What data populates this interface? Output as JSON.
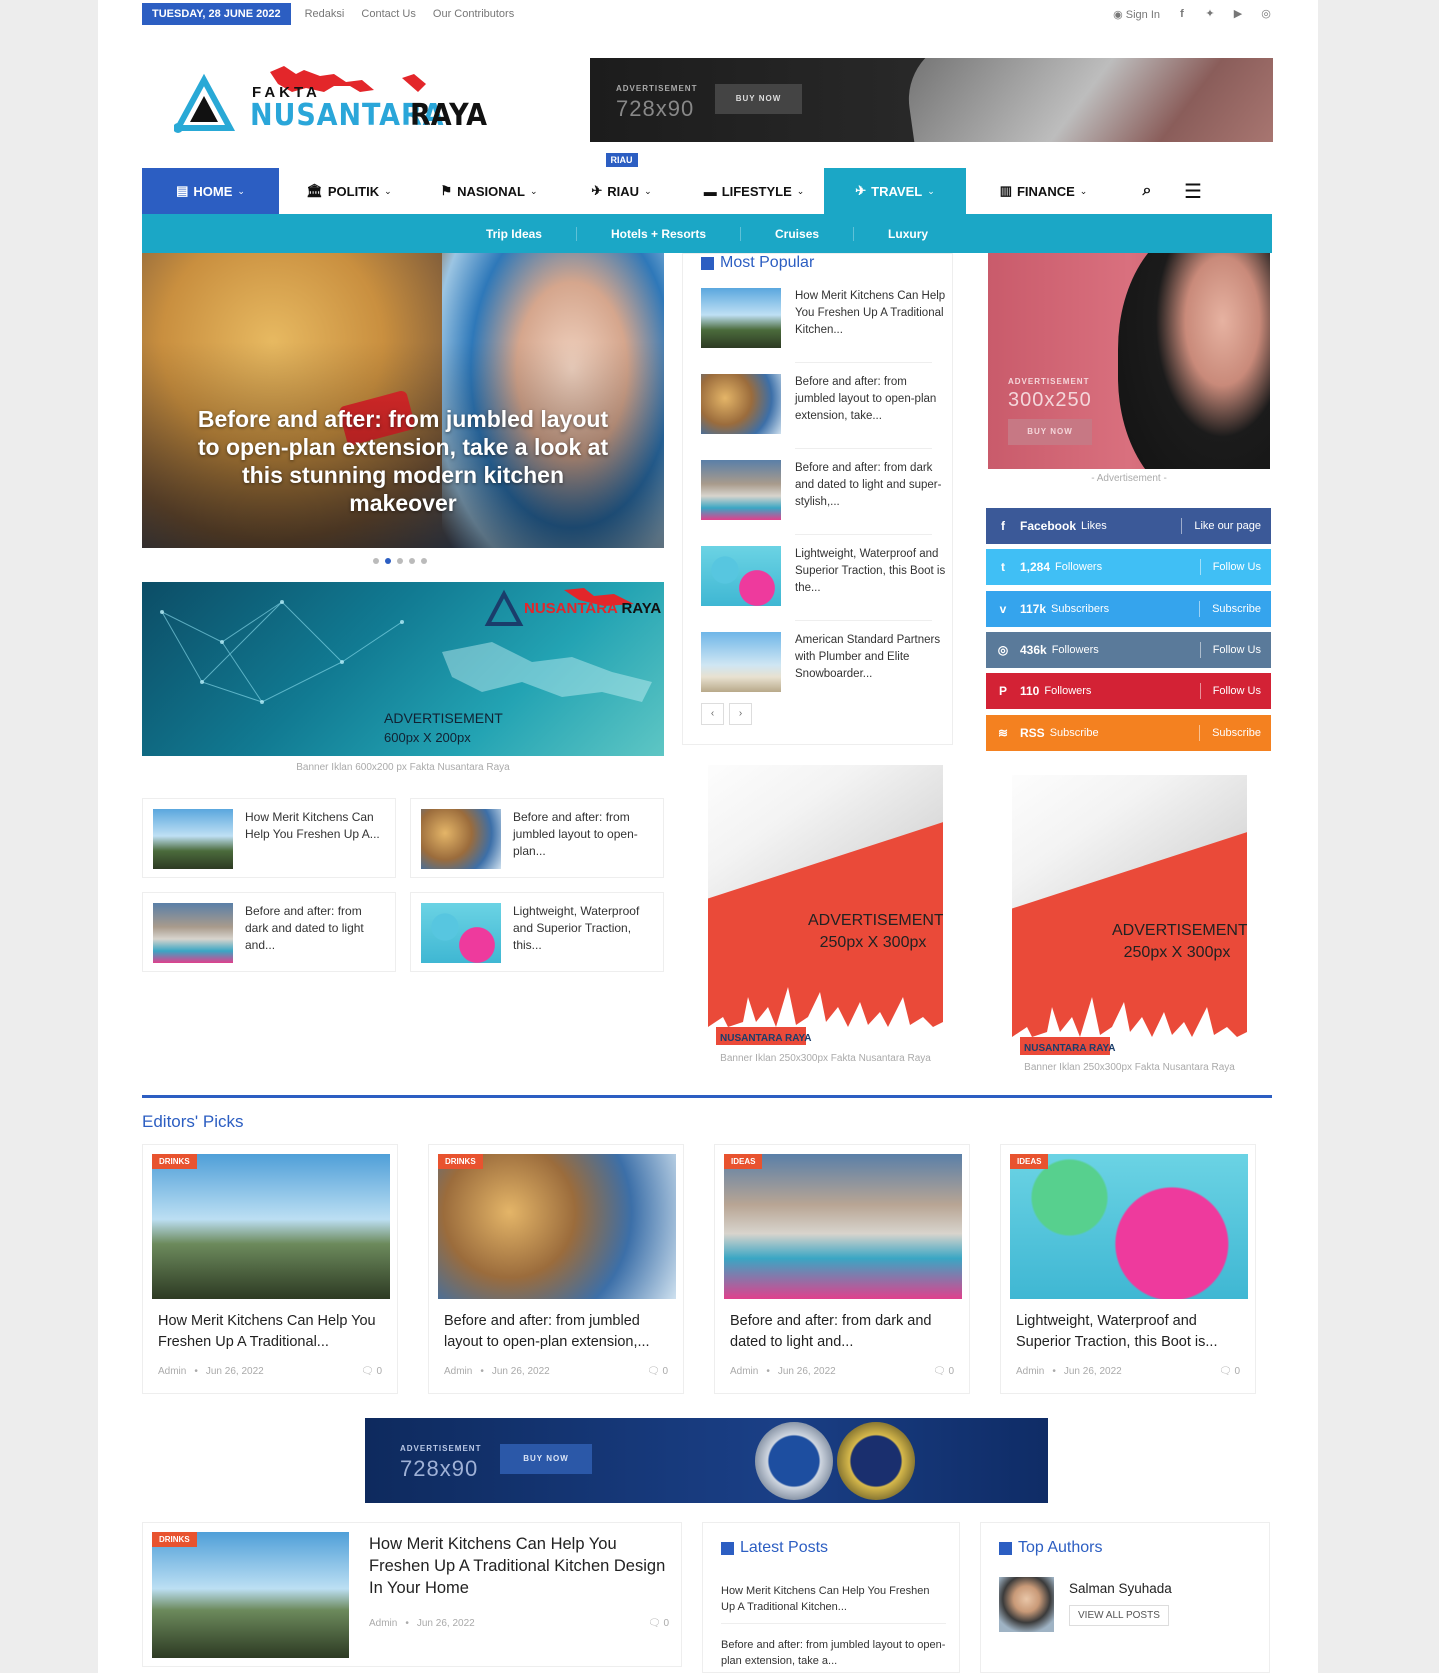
{
  "topbar": {
    "date": "TUESDAY, 28 JUNE 2022",
    "links": [
      "Redaksi",
      "Contact Us",
      "Our Contributors"
    ],
    "signin": "Sign In",
    "social_icons": [
      "facebook-icon",
      "twitter-icon",
      "youtube-icon",
      "instagram-icon"
    ]
  },
  "logo": {
    "top": "FAKTA",
    "main": "NUSANTARA",
    "accent": "RAYA"
  },
  "ad_top": {
    "label": "ADVERTISEMENT",
    "size": "728x90",
    "button": "BUY NOW"
  },
  "nav": {
    "items": [
      {
        "label": "HOME"
      },
      {
        "label": "POLITIK"
      },
      {
        "label": "NASIONAL"
      },
      {
        "label": "RIAU",
        "tag": "RIAU"
      },
      {
        "label": "LIFESTYLE"
      },
      {
        "label": "TRAVEL"
      },
      {
        "label": "FINANCE"
      }
    ],
    "sub": [
      "Trip Ideas",
      "Hotels + Resorts",
      "Cruises",
      "Luxury"
    ]
  },
  "hero": {
    "title": "Before and after: from jumbled layout to open-plan extension, take a look at this stunning modern kitchen makeover"
  },
  "ad600": {
    "label": "ADVERTISEMENT",
    "size": "600px X 200px",
    "caption": "Banner Iklan 600x200 px Fakta Nusantara Raya"
  },
  "small_posts": [
    "How Merit Kitchens Can Help You Freshen Up A...",
    "Before and after: from jumbled layout to open-plan...",
    "Before and after: from dark and dated to light and...",
    "Lightweight, Waterproof and Superior Traction, this..."
  ],
  "popular": {
    "title": "Most Popular",
    "items": [
      "How Merit Kitchens Can Help You Freshen Up A Traditional Kitchen...",
      "Before and after: from jumbled layout to open-plan extension, take...",
      "Before and after: from dark and dated to light and super-stylish,...",
      "Lightweight, Waterproof and Superior Traction, this Boot is the...",
      "American Standard Partners with Plumber and Elite Snowboarder..."
    ],
    "prev": "‹",
    "next": "›"
  },
  "ad300": {
    "label": "ADVERTISEMENT",
    "size": "300x250",
    "button": "BUY NOW",
    "caption": "- Advertisement -"
  },
  "social": [
    {
      "icon": "f",
      "count": "Facebook",
      "unit": "Likes",
      "action": "Like our page",
      "color": "#3b5998"
    },
    {
      "icon": "t",
      "count": "1,284",
      "unit": "Followers",
      "action": "Follow Us",
      "color": "#40bff5"
    },
    {
      "icon": "v",
      "count": "117k",
      "unit": "Subscribers",
      "action": "Subscribe",
      "color": "#35a4ed"
    },
    {
      "icon": "◎",
      "count": "436k",
      "unit": "Followers",
      "action": "Follow Us",
      "color": "#5a7a9a"
    },
    {
      "icon": "P",
      "count": "110",
      "unit": "Followers",
      "action": "Follow Us",
      "color": "#d32235"
    },
    {
      "icon": "≋",
      "count": "RSS",
      "unit": "Subscribe",
      "action": "Subscribe",
      "color": "#f48120"
    }
  ],
  "flag_ads": [
    {
      "label": "ADVERTISEMENT",
      "size": "250px X 300px",
      "caption": "Banner Iklan 250x300px Fakta Nusantara Raya"
    },
    {
      "label": "ADVERTISEMENT",
      "size": "250px X 300px",
      "caption": "Banner Iklan 250x300px Fakta Nusantara Raya"
    }
  ],
  "editors": {
    "title": "Editors' Picks",
    "cards": [
      {
        "tag": "DRINKS",
        "title": "How Merit Kitchens Can Help You Freshen Up A Traditional...",
        "author": "Admin",
        "date": "Jun 26, 2022",
        "comments": "0"
      },
      {
        "tag": "DRINKS",
        "title": "Before and after: from jumbled layout to open-plan extension,...",
        "author": "Admin",
        "date": "Jun 26, 2022",
        "comments": "0"
      },
      {
        "tag": "IDEAS",
        "title": "Before and after: from dark and dated to light and...",
        "author": "Admin",
        "date": "Jun 26, 2022",
        "comments": "0"
      },
      {
        "tag": "IDEAS",
        "title": "Lightweight, Waterproof and Superior Traction, this Boot is...",
        "author": "Admin",
        "date": "Jun 26, 2022",
        "comments": "0"
      }
    ]
  },
  "ad_bottom": {
    "label": "ADVERTISEMENT",
    "size": "728x90",
    "button": "BUY NOW"
  },
  "big_post": {
    "tag": "DRINKS",
    "title": "How Merit Kitchens Can Help You Freshen Up A Traditional Kitchen Design In Your Home",
    "author": "Admin",
    "date": "Jun 26, 2022",
    "comments": "0"
  },
  "latest": {
    "title": "Latest Posts",
    "items": [
      "How Merit Kitchens Can Help You Freshen Up A Traditional Kitchen...",
      "Before and after: from jumbled layout to open-plan extension, take a..."
    ]
  },
  "authors": {
    "title": "Top Authors",
    "name": "Salman Syuhada",
    "button": "VIEW ALL POSTS"
  },
  "colors": {
    "brand": "#2c5ec2",
    "travel": "#1ba7c6",
    "tag": "#e8532f"
  }
}
